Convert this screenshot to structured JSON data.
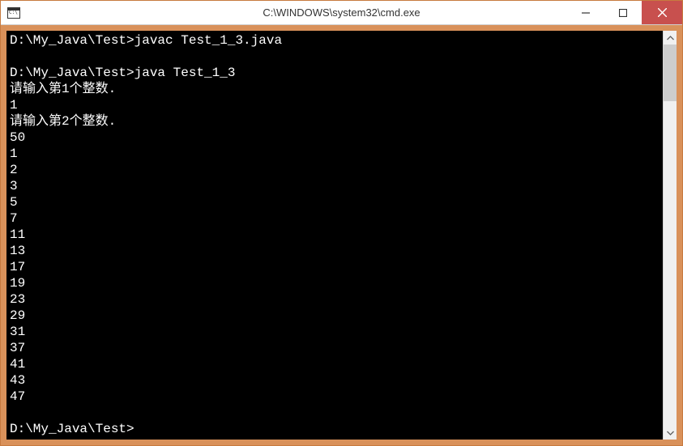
{
  "window": {
    "title": "C:\\WINDOWS\\system32\\cmd.exe"
  },
  "console": {
    "lines": [
      {
        "prompt": "D:\\My_Java\\Test>",
        "cmd": "javac Test_1_3.java"
      },
      {
        "text": ""
      },
      {
        "prompt": "D:\\My_Java\\Test>",
        "cmd": "java Test_1_3"
      },
      {
        "text": "请输入第1个整数."
      },
      {
        "text": "1"
      },
      {
        "text": "请输入第2个整数."
      },
      {
        "text": "50"
      },
      {
        "text": "1"
      },
      {
        "text": "2"
      },
      {
        "text": "3"
      },
      {
        "text": "5"
      },
      {
        "text": "7"
      },
      {
        "text": "11"
      },
      {
        "text": "13"
      },
      {
        "text": "17"
      },
      {
        "text": "19"
      },
      {
        "text": "23"
      },
      {
        "text": "29"
      },
      {
        "text": "31"
      },
      {
        "text": "37"
      },
      {
        "text": "41"
      },
      {
        "text": "43"
      },
      {
        "text": "47"
      },
      {
        "text": ""
      },
      {
        "prompt": "D:\\My_Java\\Test>",
        "cmd": ""
      }
    ]
  }
}
